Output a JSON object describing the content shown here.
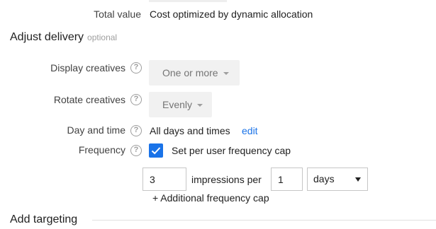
{
  "total_value": {
    "label": "Total value",
    "value": "Cost optimized by dynamic allocation"
  },
  "adjust_delivery": {
    "title": "Adjust delivery",
    "subtitle": "optional",
    "display_creatives": {
      "label": "Display creatives",
      "value": "One or more"
    },
    "rotate_creatives": {
      "label": "Rotate creatives",
      "value": "Evenly"
    },
    "day_and_time": {
      "label": "Day and time",
      "value": "All days and times",
      "edit_link": "edit"
    },
    "frequency": {
      "label": "Frequency",
      "checkbox_checked": true,
      "checkbox_label": "Set per user frequency cap",
      "impressions_value": "3",
      "impressions_per_text": "impressions per",
      "period_value": "1",
      "period_unit": "days",
      "add_cap_link": "+ Additional frequency cap"
    }
  },
  "add_targeting": {
    "title": "Add targeting"
  },
  "colors": {
    "accent": "#1a73e8",
    "button_bg": "#f1f1f1",
    "muted_text": "#9e9e9e"
  },
  "icons": {
    "help": "help-circle-icon",
    "check": "check-icon",
    "dropdown": "chevron-down-icon"
  }
}
